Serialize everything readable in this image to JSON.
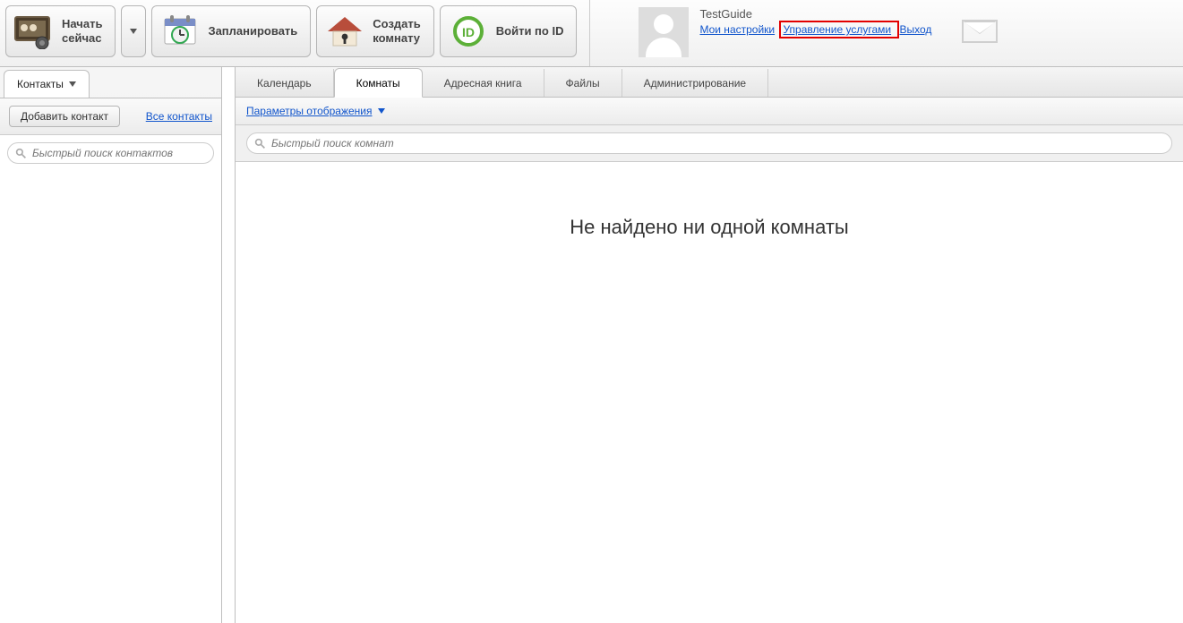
{
  "toolbar": {
    "start_now_line1": "Начать",
    "start_now_line2": "сейчас",
    "schedule": "Запланировать",
    "create_room_line1": "Создать",
    "create_room_line2": "комнату",
    "login_by_id": "Войти по ID"
  },
  "user": {
    "name": "TestGuide",
    "my_settings": "Мои настройки",
    "manage_services": "Управление услугами",
    "logout": "Выход"
  },
  "sidebar": {
    "tab_label": "Контакты",
    "add_contact": "Добавить контакт",
    "all_contacts": "Все контакты",
    "search_placeholder": "Быстрый поиск контактов"
  },
  "main_tabs": {
    "calendar": "Календарь",
    "rooms": "Комнаты",
    "address_book": "Адресная книга",
    "files": "Файлы",
    "admin": "Администрирование"
  },
  "main": {
    "display_params": "Параметры отображения",
    "search_placeholder": "Быстрый поиск комнат",
    "empty": "Не найдено ни одной комнаты"
  }
}
